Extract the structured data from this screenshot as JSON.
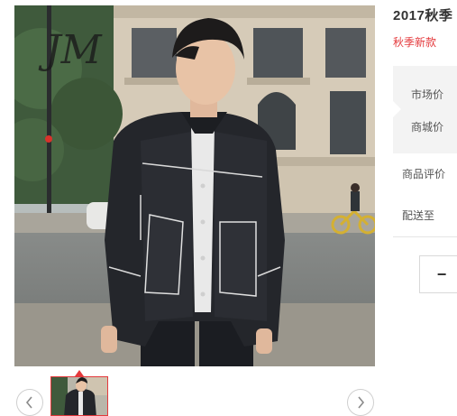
{
  "product": {
    "title": "2017秋季",
    "subtitle": "秋季新款"
  },
  "price_panel": {
    "market_price_label": "市场价",
    "mall_price_label": "商城价"
  },
  "info": {
    "reviews_label": "商品评价",
    "delivery_label": "配送至"
  },
  "quantity": {
    "minus_symbol": "−"
  },
  "gallery": {
    "watermark": "JM",
    "prev_icon": "chevron-left-icon",
    "next_icon": "chevron-right-icon"
  },
  "colors": {
    "accent": "#e4393c",
    "panel_bg": "#f3f3f3"
  }
}
